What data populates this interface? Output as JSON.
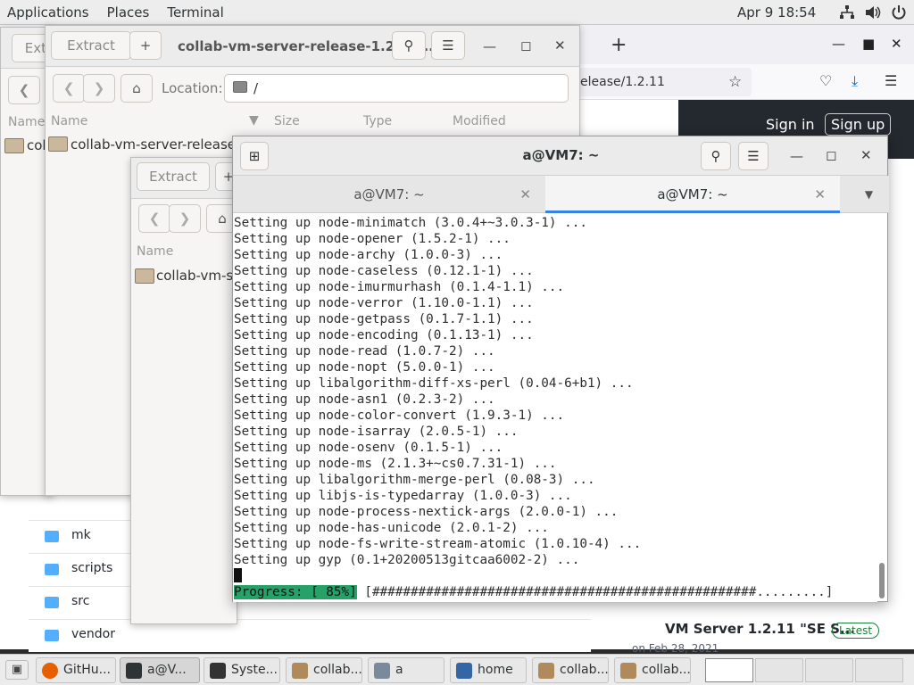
{
  "top_panel": {
    "menus": [
      "Applications",
      "Places",
      "Terminal"
    ],
    "clock": "Apr 9  18:54",
    "tray_icons": [
      "network-icon",
      "volume-icon",
      "power-icon"
    ]
  },
  "browser": {
    "url_text": "elease/1.2.11",
    "sign_in": "Sign in",
    "sign_up": "Sign up",
    "release_title": "VM Server 1.2.11 \"SE S...",
    "latest_badge": "Latest",
    "release_date": "on Feb 28, 2021",
    "repo_files": [
      "mk",
      "scripts",
      "src",
      "vendor"
    ]
  },
  "archive_back": {
    "extract_label": "Extr",
    "name_header": "Name",
    "folder_label": "col"
  },
  "archive_mid": {
    "extract_label": "Extract",
    "title": "collab-vm-server-release-1.2.11...",
    "location_label": "Location:",
    "location_value": "/",
    "columns": [
      "Name",
      "Size",
      "Type",
      "Modified"
    ],
    "folder_label": "collab-vm-server-release-1"
  },
  "archive_front": {
    "extract_label": "Extract",
    "name_header": "Name",
    "folder_label": "collab-vm-se"
  },
  "terminal": {
    "title": "a@VM7: ~",
    "tabs": [
      "a@VM7: ~",
      "a@VM7: ~"
    ],
    "lines": [
      "Setting up node-minimatch (3.0.4+~3.0.3-1) ...",
      "Setting up node-opener (1.5.2-1) ...",
      "Setting up node-archy (1.0.0-3) ...",
      "Setting up node-caseless (0.12.1-1) ...",
      "Setting up node-imurmurhash (0.1.4-1.1) ...",
      "Setting up node-verror (1.10.0-1.1) ...",
      "Setting up node-getpass (0.1.7-1.1) ...",
      "Setting up node-encoding (0.1.13-1) ...",
      "Setting up node-read (1.0.7-2) ...",
      "Setting up node-nopt (5.0.0-1) ...",
      "Setting up libalgorithm-diff-xs-perl (0.04-6+b1) ...",
      "Setting up node-asn1 (0.2.3-2) ...",
      "Setting up node-color-convert (1.9.3-1) ...",
      "Setting up node-isarray (2.0.5-1) ...",
      "Setting up node-osenv (0.1.5-1) ...",
      "Setting up node-ms (2.1.3+~cs0.7.31-1) ...",
      "Setting up libalgorithm-merge-perl (0.08-3) ...",
      "Setting up libjs-is-typedarray (1.0.0-3) ...",
      "Setting up node-process-nextick-args (2.0.0-1) ...",
      "Setting up node-has-unicode (2.0.1-2) ...",
      "Setting up node-fs-write-stream-atomic (1.0.10-4) ...",
      "Setting up gyp (0.1+20200513gitcaa6002-2) ..."
    ],
    "progress_label": "Progress: [ 85%]",
    "progress_bar": " [##################################################.........]",
    "progress_percent": 85
  },
  "taskbar": {
    "tasks": [
      "GitHu...",
      "a@V...",
      "Syste...",
      "collab...",
      "a",
      "home",
      "collab...",
      "collab..."
    ]
  }
}
